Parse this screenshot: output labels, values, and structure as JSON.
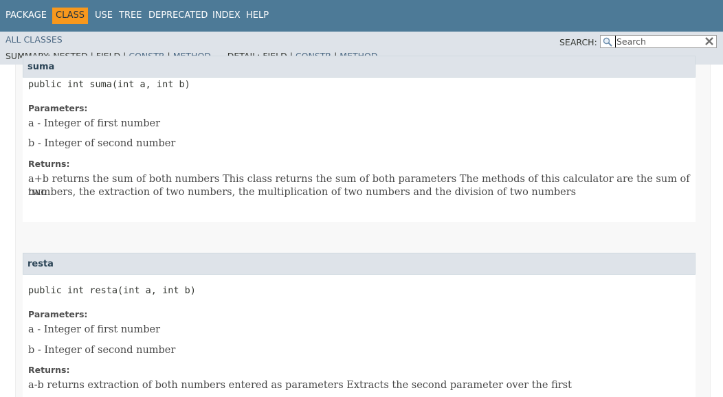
{
  "topnav": {
    "items": [
      {
        "label": "PACKAGE",
        "active": false
      },
      {
        "label": "CLASS",
        "active": true
      },
      {
        "label": "USE",
        "active": false
      },
      {
        "label": "TREE",
        "active": false
      },
      {
        "label": "DEPRECATED",
        "active": false
      },
      {
        "label": "INDEX",
        "active": false
      },
      {
        "label": "HELP",
        "active": false
      }
    ]
  },
  "subnav": {
    "all_classes": "ALL CLASSES",
    "summary_label": "SUMMARY:",
    "summary_nested": "NESTED",
    "summary_field": "FIELD",
    "summary_constr": "CONSTR",
    "summary_method": "METHOD",
    "detail_label": "DETAIL:",
    "detail_field": "FIELD",
    "detail_constr": "CONSTR",
    "detail_method": "METHOD",
    "separator": "|",
    "search_label": "SEARCH:",
    "search_placeholder": "Search"
  },
  "methods": [
    {
      "name": "suma",
      "signature": "public int suma(int a, int b)",
      "parameters_label": "Parameters:",
      "params": [
        {
          "name": "a",
          "desc": " - Integer of first number"
        },
        {
          "name": "b",
          "desc": " - Integer of second number"
        }
      ],
      "returns_label": "Returns:",
      "returns_line1": "a+b returns the sum of both numbers This class returns the sum of both parameters The methods of this calculator are the sum of two",
      "returns_line2": "numbers, the extraction of two numbers, the multiplication of two numbers and the division of two numbers"
    },
    {
      "name": "resta",
      "signature": "public int resta(int a, int b)",
      "parameters_label": "Parameters:",
      "params": [
        {
          "name": "a",
          "desc": " - Integer of first number"
        },
        {
          "name": "b",
          "desc": " - Integer of second number"
        }
      ],
      "returns_label": "Returns:",
      "returns_line1": "a-b returns extraction of both numbers entered as parameters Extracts the second parameter over the first"
    }
  ],
  "colors": {
    "nav_bg": "#4D7A97",
    "active_tab": "#F8981D",
    "subnav_bg": "#dee3e9",
    "link": "#4A6782"
  },
  "icons": {
    "search": "search-icon",
    "reset": "reset-icon"
  }
}
